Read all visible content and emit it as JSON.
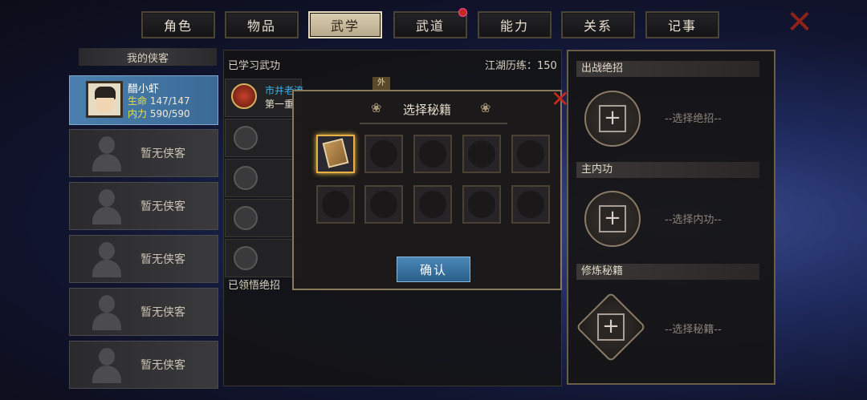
{
  "tabs": [
    {
      "label": "角色"
    },
    {
      "label": "物品"
    },
    {
      "label": "武学"
    },
    {
      "label": "武道"
    },
    {
      "label": "能力"
    },
    {
      "label": "关系"
    },
    {
      "label": "记事"
    }
  ],
  "active_tab": "武学",
  "left": {
    "header": "我的侠客",
    "hero": {
      "name": "醋小虾",
      "hp_label": "生命",
      "hp": "147/147",
      "mp_label": "内力",
      "mp": "590/590"
    },
    "empty_label": "暂无侠客"
  },
  "middle": {
    "title": "已学习武功",
    "points": "江湖历练：150",
    "skill_name": "市井老流",
    "skill_sub": "第一重",
    "tag": "外",
    "footer": "已领悟绝招"
  },
  "modal": {
    "title": "选择秘籍",
    "confirm": "确认"
  },
  "right": {
    "sections": [
      {
        "label": "出战绝招",
        "placeholder": "--选择绝招--"
      },
      {
        "label": "主内功",
        "placeholder": "--选择内功--"
      },
      {
        "label": "修炼秘籍",
        "placeholder": "--选择秘籍--"
      }
    ]
  },
  "colors": {
    "accent_blue": "#3b6a96",
    "confirm_blue": "#2a5e8a",
    "close_red": "#c42b1c",
    "gold": "#e8b040"
  }
}
